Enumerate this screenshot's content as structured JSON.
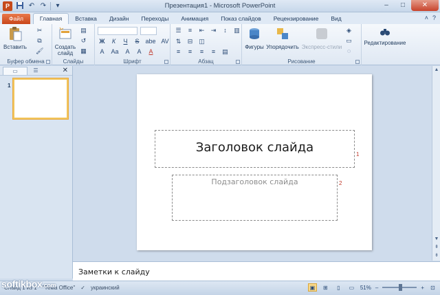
{
  "window": {
    "title": "Презентация1  -  Microsoft PowerPoint",
    "app_icon_letter": "P",
    "qat": {
      "save_icon": "save-icon",
      "undo_icon": "undo-icon",
      "redo_icon": "redo-icon",
      "customize_icon": "dropdown-icon"
    },
    "controls": {
      "minimize": "–",
      "maximize": "□",
      "close": "✕"
    }
  },
  "tabs": {
    "file": "Файл",
    "items": [
      "Главная",
      "Вставка",
      "Дизайн",
      "Переходы",
      "Анимация",
      "Показ слайдов",
      "Рецензирование",
      "Вид"
    ],
    "active": "Главная",
    "help_icon": "?",
    "minimize_ribbon_icon": "˄"
  },
  "ribbon": {
    "clipboard": {
      "paste_label": "Вставить",
      "group_label": "Буфер обмена"
    },
    "slides": {
      "create_label": "Создать слайд",
      "group_label": "Слайды"
    },
    "font": {
      "bold": "Ж",
      "italic": "К",
      "underline": "Ч",
      "strike": "S",
      "shadow": "abe",
      "spacing": "AV",
      "grow": "A",
      "shrink": "A",
      "case": "Aa",
      "clear": "A",
      "color": "A",
      "group_label": "Шрифт"
    },
    "paragraph": {
      "group_label": "Абзац"
    },
    "drawing": {
      "shapes_label": "Фигуры",
      "arrange_label": "Упорядочить",
      "quick_styles_label": "Экспресс-стили",
      "group_label": "Рисование"
    },
    "editing": {
      "label": "Редактирование"
    }
  },
  "leftpanel": {
    "tab_slides": "▭",
    "tab_outline": "☰",
    "close": "✕",
    "thumbnail_number": "1"
  },
  "slide": {
    "title_placeholder": "Заголовок слайда",
    "subtitle_placeholder": "Подзаголовок слайда",
    "title_number": "1",
    "subtitle_number": "2"
  },
  "notes": {
    "placeholder": "Заметки к слайду"
  },
  "statusbar": {
    "slide_info": "Слайд 1 из 1",
    "theme": "\"Тема Office\"",
    "language": "украинский",
    "zoom": "51%",
    "zoom_minus": "–",
    "zoom_plus": "+",
    "watermark_main": "softikbox",
    "watermark_suffix": ".com"
  },
  "colors": {
    "accent_file": "#c9461a",
    "ribbon_bg": "#dfe8f3",
    "selection": "#f2c55c"
  }
}
